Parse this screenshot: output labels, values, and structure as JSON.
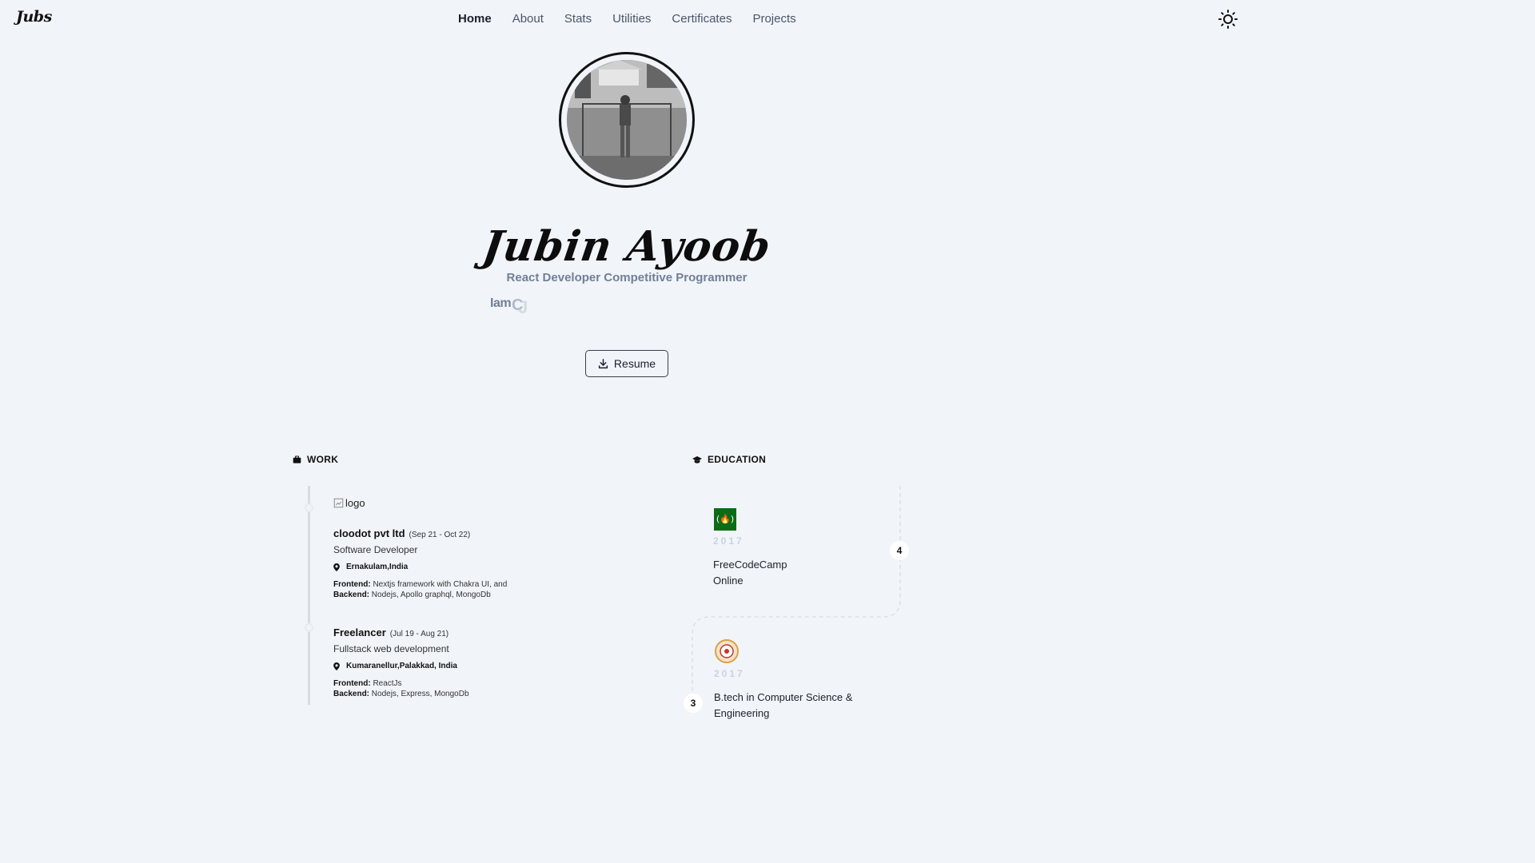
{
  "nav": {
    "logo": "Jubs",
    "links": [
      {
        "label": "Home",
        "active": true
      },
      {
        "label": "About"
      },
      {
        "label": "Stats"
      },
      {
        "label": "Utilities"
      },
      {
        "label": "Certificates"
      },
      {
        "label": "Projects"
      }
    ],
    "theme_icon": "sun-icon"
  },
  "hero": {
    "name": "Jubin Ayoob",
    "tagline": "React Developer Competitive Programmer",
    "typing_text": "Iam",
    "resume_label": "Resume"
  },
  "work": {
    "heading": "WORK",
    "logo_alt": "logo",
    "jobs": [
      {
        "company": "cloodot pvt ltd",
        "dates": "(Sep 21 - Oct 22)",
        "role": "Software Developer",
        "location": "Ernakulam,India",
        "frontend_label": "Frontend:",
        "frontend": "Nextjs framework with Chakra UI, and",
        "backend_label": "Backend:",
        "backend": "Nodejs, Apollo graphql, MongoDb"
      },
      {
        "company": "Freelancer",
        "dates": "(Jul 19 - Aug 21)",
        "role": "Fullstack web development",
        "location": "Kumaranellur,Palakkad, India",
        "frontend_label": "Frontend:",
        "frontend": "ReactJs",
        "backend_label": "Backend:",
        "backend": "Nodejs, Express, MongoDb"
      }
    ]
  },
  "education": {
    "heading": "EDUCATION",
    "items": [
      {
        "badge": "4",
        "year": "2017",
        "title_line1": "FreeCodeCamp",
        "title_line2": "Online"
      },
      {
        "badge": "3",
        "year": "2017",
        "title_line1": "B.tech in Computer Science &",
        "title_line2": "Engineering"
      }
    ]
  },
  "colors": {
    "background": "#f1f4f9",
    "fcc_green": "#0a6d16",
    "muted_text": "#718096"
  }
}
